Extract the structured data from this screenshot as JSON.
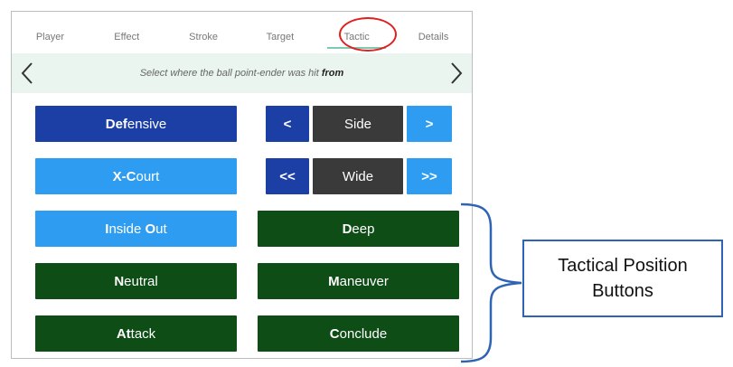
{
  "tabs": [
    {
      "label": "Player"
    },
    {
      "label": "Effect"
    },
    {
      "label": "Stroke"
    },
    {
      "label": "Target"
    },
    {
      "label": "Tactic",
      "active": true
    },
    {
      "label": "Details"
    }
  ],
  "hint": {
    "prefix": "Select where the ball point-ender was hit ",
    "emphasis": "from"
  },
  "buttons": {
    "defensive": {
      "strong": "Def",
      "rest": "ensive"
    },
    "x_court": {
      "strong": "X-C",
      "rest": "ourt"
    },
    "inside_out": {
      "strong1": "I",
      "mid": "nside ",
      "strong2": "O",
      "rest": "ut"
    },
    "neutral": {
      "strong": "N",
      "rest": "eutral"
    },
    "attack": {
      "strong": "At",
      "rest": "tack"
    },
    "side_prev": "<",
    "side_value": "Side",
    "side_next": ">",
    "wide_prev": "<<",
    "wide_value": "Wide",
    "wide_next": ">>",
    "deep": {
      "strong": "D",
      "rest": "eep"
    },
    "maneuver": {
      "strong": "M",
      "rest": "aneuver"
    },
    "conclude": {
      "strong": "C",
      "rest": "onclude"
    }
  },
  "callout": {
    "line1": "Tactical Position",
    "line2": "Buttons"
  },
  "colors": {
    "navy": "#1c3fa6",
    "light_blue": "#2e9cf0",
    "dark_green": "#0e4d16",
    "dark_gray": "#3a3a3a",
    "highlight_red": "#e02020",
    "callout_blue": "#2f63b5"
  }
}
